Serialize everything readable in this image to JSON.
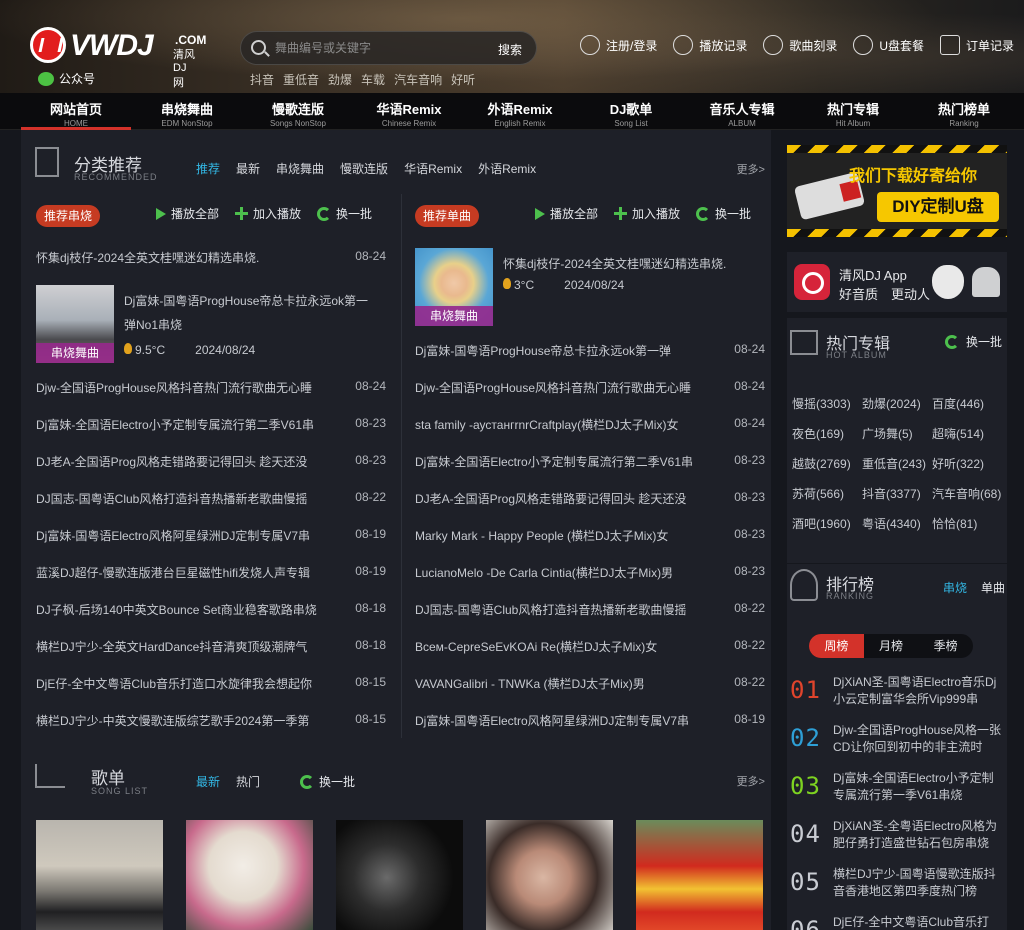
{
  "header": {
    "logo_text": "VWDJ",
    "logo_com": ".COM",
    "logo_sub": "清风DJ网",
    "wechat_label": "公众号",
    "search_placeholder": "舞曲编号或关键字",
    "search_button": "搜索",
    "hot_words": [
      "抖音",
      "重低音",
      "劲爆",
      "车载",
      "汽车音响",
      "好听"
    ],
    "links": [
      {
        "label": "注册/登录",
        "icon": "user-icon"
      },
      {
        "label": "播放记录",
        "icon": "clock-icon"
      },
      {
        "label": "歌曲刻录",
        "icon": "disc-icon"
      },
      {
        "label": "U盘套餐",
        "icon": "usb-icon"
      },
      {
        "label": "订单记录",
        "icon": "order-icon"
      }
    ]
  },
  "nav": [
    {
      "cn": "网站首页",
      "en": "HOME"
    },
    {
      "cn": "串烧舞曲",
      "en": "EDM NonStop"
    },
    {
      "cn": "慢歌连版",
      "en": "Songs NonStop"
    },
    {
      "cn": "华语Remix",
      "en": "Chinese Remix"
    },
    {
      "cn": "外语Remix",
      "en": "English Remix"
    },
    {
      "cn": "DJ歌单",
      "en": "Song List"
    },
    {
      "cn": "音乐人专辑",
      "en": "ALBUM"
    },
    {
      "cn": "热门专辑",
      "en": "Hit Album"
    },
    {
      "cn": "热门榜单",
      "en": "Ranking"
    }
  ],
  "category": {
    "title": "分类推荐",
    "subtitle": "RECOMMENDED",
    "tabs": [
      "推荐",
      "最新",
      "串烧舞曲",
      "慢歌连版",
      "华语Remix",
      "外语Remix"
    ],
    "more": "更多>",
    "controls": {
      "play_all": "播放全部",
      "add": "加入播放",
      "swap": "换一批"
    },
    "left": {
      "badge": "推荐串烧",
      "first": {
        "title": "怀集dj枝仔-2024全英文桂嘿迷幻精选串烧.",
        "date": "08-24"
      },
      "feature": {
        "title": "Dj富妹-国粤语ProgHouse帝总卡拉永远ok第一弹No1串烧",
        "label": "串烧舞曲",
        "heat": "9.5°C",
        "date": "2024/08/24"
      },
      "rows": [
        {
          "title": "Djw-全国语ProgHouse风格抖音热门流行歌曲无心睡",
          "date": "08-24"
        },
        {
          "title": "Dj富妹-全国语Electro小予定制专属流行第二季V61串",
          "date": "08-23"
        },
        {
          "title": "DJ老A-全国语Prog风格走错路要记得回头 趁天还没",
          "date": "08-23"
        },
        {
          "title": "DJ国志-国粤语Club风格打造抖音热播新老歌曲慢摇",
          "date": "08-22"
        },
        {
          "title": "Dj富妹-国粤语Electro风格阿星绿洲DJ定制专属V7串",
          "date": "08-19"
        },
        {
          "title": "蓝溪DJ超仔-慢歌连版港台巨星磁性hifi发烧人声专辑",
          "date": "08-19"
        },
        {
          "title": "DJ子枫-后场140中英文Bounce Set商业稳客歌路串烧",
          "date": "08-18"
        },
        {
          "title": "横栏DJ宁少-全英文HardDance抖音清爽顶级潮牌气",
          "date": "08-18"
        },
        {
          "title": "DjE仔-全中文粤语Club音乐打造口水旋律我会想起你",
          "date": "08-15"
        },
        {
          "title": "横栏DJ宁少-中英文慢歌连版综艺歌手2024第一季第",
          "date": "08-15"
        }
      ]
    },
    "right": {
      "badge": "推荐单曲",
      "feature": {
        "title": "怀集dj枝仔-2024全英文桂嘿迷幻精选串烧.",
        "label": "串烧舞曲",
        "heat": "3°C",
        "date": "2024/08/24"
      },
      "rows": [
        {
          "title": "Dj富妹-国粤语ProgHouse帝总卡拉永远ok第一弹",
          "date": "08-24"
        },
        {
          "title": "Djw-全国语ProgHouse风格抖音热门流行歌曲无心睡",
          "date": "08-24"
        },
        {
          "title": "sta family -аустангrnrCraftplay(横栏DJ太子Mix)女",
          "date": "08-24"
        },
        {
          "title": "Dj富妹-全国语Electro小予定制专属流行第二季V61串",
          "date": "08-23"
        },
        {
          "title": "DJ老A-全国语Prog风格走错路要记得回头 趁天还没",
          "date": "08-23"
        },
        {
          "title": "Marky Mark - Happy People (横栏DJ太子Mix)女",
          "date": "08-23"
        },
        {
          "title": "LucianoMelo -De Carla Cintia(横栏DJ太子Mix)男",
          "date": "08-23"
        },
        {
          "title": "DJ国志-国粤语Club风格打造抖音热播新老歌曲慢摇",
          "date": "08-22"
        },
        {
          "title": "Всем-CepreSeEvKOAi Re(横栏DJ太子Mix)女",
          "date": "08-22"
        },
        {
          "title": "VAVANGalibri - TNWKa (横栏DJ太子Mix)男",
          "date": "08-22"
        },
        {
          "title": "Dj富妹-国粤语Electro风格阿星绿洲DJ定制专属V7串",
          "date": "08-19"
        }
      ]
    }
  },
  "songlist": {
    "title": "歌单",
    "subtitle": "SONG LIST",
    "tabs": [
      "最新",
      "热门"
    ],
    "swap": "换一批",
    "more": "更多>"
  },
  "sidebar": {
    "banner": {
      "line1": "我们下载好寄给你",
      "line2": "DIY定制U盘"
    },
    "app": {
      "line1": "清风DJ App",
      "line2": "好音质　更动人"
    },
    "album": {
      "title": "热门专辑",
      "subtitle": "HOT ALBUM",
      "swap": "换一批",
      "tags": [
        "慢摇(3303)",
        "劲爆(2024)",
        "百度(446)",
        "夜色(169)",
        "广场舞(5)",
        "超嗨(514)",
        "越鼓(2769)",
        "重低音(243)",
        "好听(322)",
        "苏荷(566)",
        "抖音(3377)",
        "汽车音响(68)",
        "酒吧(1960)",
        "粤语(4340)",
        "恰恰(81)"
      ]
    },
    "ranking": {
      "title": "排行榜",
      "subtitle": "RANKING",
      "tabs": [
        "串烧",
        "单曲"
      ],
      "periods": [
        "周榜",
        "月榜",
        "季榜"
      ],
      "items": [
        {
          "num": "01",
          "title": "DjXiAN圣-国粤语Electro音乐Dj小云定制富华会所Vip999串",
          "color": "#e0442c"
        },
        {
          "num": "02",
          "title": "Djw-全国语ProgHouse风格一张CD让你回到初中的非主流时",
          "color": "#2e9fd6"
        },
        {
          "num": "03",
          "title": "Dj富妹-全国语Electro小予定制专属流行第一季V61串烧",
          "color": "#7ed321"
        },
        {
          "num": "04",
          "title": "DjXiAN圣-全粤语Electro风格为肥仔勇打造盛世钻石包房串烧",
          "color": "#c7cad0"
        },
        {
          "num": "05",
          "title": "横栏DJ宁少-国粤语慢歌连版抖音香港地区第四季度热门榜",
          "color": "#c7cad0"
        },
        {
          "num": "06",
          "title": "DjE仔-全中文粤语Club音乐打",
          "color": "#c7cad0"
        }
      ]
    }
  }
}
